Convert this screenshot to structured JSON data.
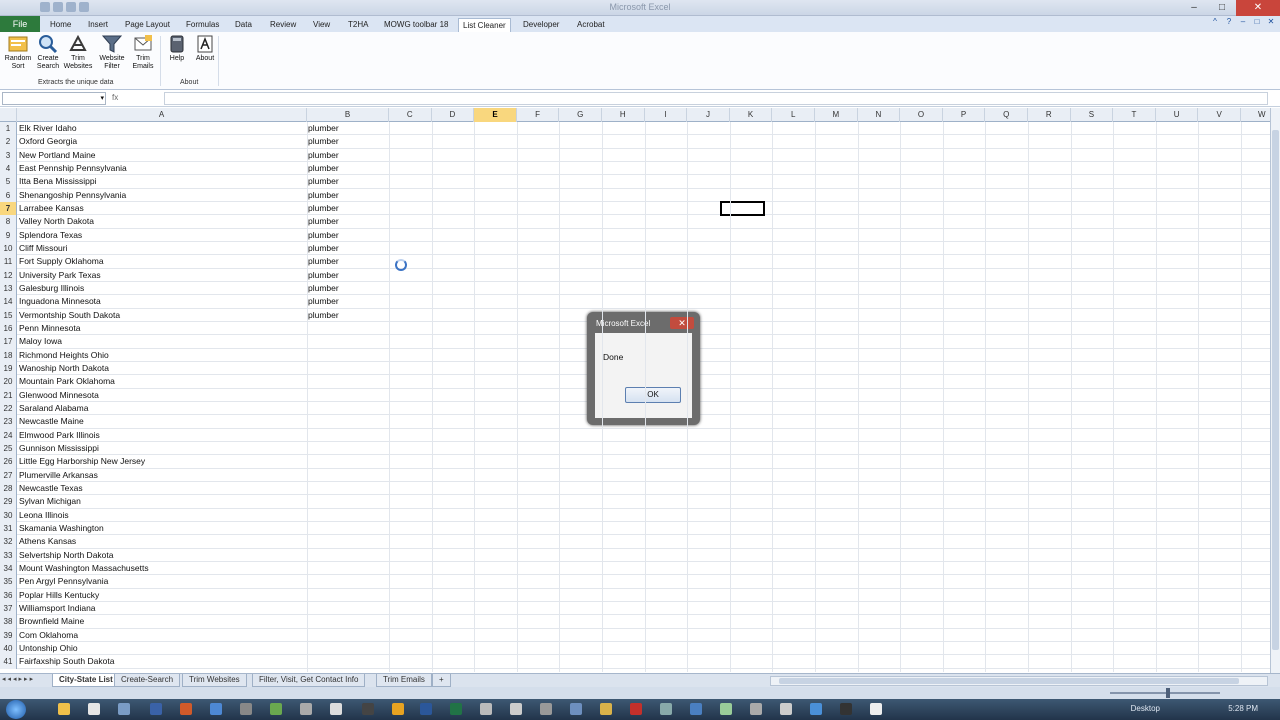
{
  "window": {
    "title": "Microsoft Excel",
    "controls": [
      "–",
      "□",
      "✕"
    ]
  },
  "ribbon": {
    "file_label": "File",
    "tabs": [
      "Home",
      "Insert",
      "Page Layout",
      "Formulas",
      "Data",
      "Review",
      "View",
      "T2HA",
      "MOWG toolbar 18",
      "List Cleaner",
      "Developer",
      "Acrobat"
    ],
    "active_tab": "List Cleaner",
    "buttons": [
      {
        "label": "Random Sort",
        "icon": "random-sort-icon"
      },
      {
        "label": "Create Search",
        "icon": "create-search-icon"
      },
      {
        "label": "Trim Websites",
        "icon": "trim-websites-icon"
      },
      {
        "label": "Website Filter",
        "icon": "filter-icon"
      },
      {
        "label": "Trim Emails",
        "icon": "trim-emails-icon"
      },
      {
        "label": "Help",
        "icon": "help-book-icon"
      },
      {
        "label": "About",
        "icon": "about-icon"
      }
    ],
    "group1_label": "Extracts the unique data",
    "group2_label": "About"
  },
  "formula_bar": {
    "fx": "fx",
    "value": ""
  },
  "columns": [
    "A",
    "B",
    "C",
    "D",
    "E",
    "F",
    "G",
    "H",
    "I",
    "J",
    "K",
    "L",
    "M",
    "N",
    "O",
    "P",
    "Q",
    "R",
    "S",
    "T",
    "U",
    "V",
    "W"
  ],
  "selected_column": "E",
  "selected_row": "7",
  "rows": [
    {
      "n": "1",
      "a": "Elk River Idaho",
      "b": "plumber"
    },
    {
      "n": "2",
      "a": "Oxford Georgia",
      "b": "plumber"
    },
    {
      "n": "3",
      "a": "New Portland Maine",
      "b": "plumber"
    },
    {
      "n": "4",
      "a": "East Pennship Pennsylvania",
      "b": "plumber"
    },
    {
      "n": "5",
      "a": "Itta Bena Mississippi",
      "b": "plumber"
    },
    {
      "n": "6",
      "a": "Shenangoship Pennsylvania",
      "b": "plumber"
    },
    {
      "n": "7",
      "a": "Larrabee Kansas",
      "b": "plumber"
    },
    {
      "n": "8",
      "a": "Valley North Dakota",
      "b": "plumber"
    },
    {
      "n": "9",
      "a": "Splendora Texas",
      "b": "plumber"
    },
    {
      "n": "10",
      "a": "Cliff Missouri",
      "b": "plumber"
    },
    {
      "n": "11",
      "a": "Fort Supply Oklahoma",
      "b": "plumber"
    },
    {
      "n": "12",
      "a": "University Park Texas",
      "b": "plumber"
    },
    {
      "n": "13",
      "a": "Galesburg Illinois",
      "b": "plumber"
    },
    {
      "n": "14",
      "a": "Inguadona Minnesota",
      "b": "plumber"
    },
    {
      "n": "15",
      "a": "Vermontship South Dakota",
      "b": "plumber"
    },
    {
      "n": "16",
      "a": "Penn Minnesota",
      "b": ""
    },
    {
      "n": "17",
      "a": "Maloy Iowa",
      "b": ""
    },
    {
      "n": "18",
      "a": "Richmond Heights Ohio",
      "b": ""
    },
    {
      "n": "19",
      "a": "Wanoship North Dakota",
      "b": ""
    },
    {
      "n": "20",
      "a": "Mountain Park Oklahoma",
      "b": ""
    },
    {
      "n": "21",
      "a": "Glenwood Minnesota",
      "b": ""
    },
    {
      "n": "22",
      "a": "Saraland Alabama",
      "b": ""
    },
    {
      "n": "23",
      "a": "Newcastle Maine",
      "b": ""
    },
    {
      "n": "24",
      "a": "Elmwood Park Illinois",
      "b": ""
    },
    {
      "n": "25",
      "a": "Gunnison Mississippi",
      "b": ""
    },
    {
      "n": "26",
      "a": "Little Egg Harborship New Jersey",
      "b": ""
    },
    {
      "n": "27",
      "a": "Plumerville Arkansas",
      "b": ""
    },
    {
      "n": "28",
      "a": "Newcastle Texas",
      "b": ""
    },
    {
      "n": "29",
      "a": "Sylvan Michigan",
      "b": ""
    },
    {
      "n": "30",
      "a": "Leona Illinois",
      "b": ""
    },
    {
      "n": "31",
      "a": "Skamania Washington",
      "b": ""
    },
    {
      "n": "32",
      "a": "Athens Kansas",
      "b": ""
    },
    {
      "n": "33",
      "a": "Selvertship North Dakota",
      "b": ""
    },
    {
      "n": "34",
      "a": "Mount Washington Massachusetts",
      "b": ""
    },
    {
      "n": "35",
      "a": "Pen Argyl Pennsylvania",
      "b": ""
    },
    {
      "n": "36",
      "a": "Poplar Hills Kentucky",
      "b": ""
    },
    {
      "n": "37",
      "a": "Williamsport Indiana",
      "b": ""
    },
    {
      "n": "38",
      "a": "Brownfield Maine",
      "b": ""
    },
    {
      "n": "39",
      "a": "Com Oklahoma",
      "b": ""
    },
    {
      "n": "40",
      "a": "Untonship Ohio",
      "b": ""
    },
    {
      "n": "41",
      "a": "Fairfaxship South Dakota",
      "b": ""
    }
  ],
  "dialog": {
    "title": "Microsoft Excel",
    "message": "Done",
    "ok_label": "OK"
  },
  "sheet_tabs": [
    "City-State List",
    "Create-Search",
    "Trim Websites",
    "Filter, Visit, Get Contact Info",
    "Trim Emails"
  ],
  "active_sheet": "City-State List",
  "taskbar": {
    "desktop_label": "Desktop",
    "clock": "5:28 PM"
  }
}
